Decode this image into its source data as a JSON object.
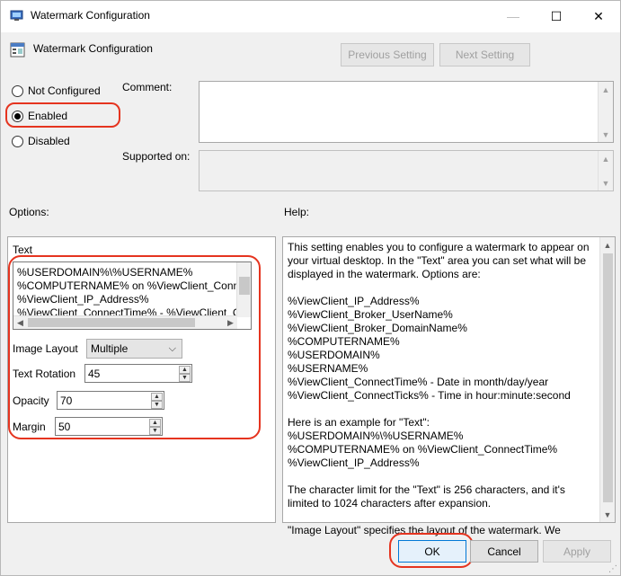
{
  "window": {
    "title": "Watermark Configuration",
    "controls": {
      "minimize": "—",
      "maximize": "☐",
      "close": "✕"
    }
  },
  "header": {
    "title": "Watermark Configuration",
    "prev_label": "Previous Setting",
    "next_label": "Next Setting"
  },
  "state": {
    "not_configured": "Not Configured",
    "enabled": "Enabled",
    "disabled": "Disabled",
    "selected": "Enabled"
  },
  "comment": {
    "label": "Comment:",
    "value": ""
  },
  "supported": {
    "label": "Supported on:",
    "value": ""
  },
  "options": {
    "label": "Options:",
    "text_label": "Text",
    "text_lines": [
      "%USERDOMAIN%\\%USERNAME%",
      "%COMPUTERNAME% on %ViewClient_Conne",
      "%ViewClient_IP_Address%",
      "%ViewClient_ConnectTime% - %ViewClient_C"
    ],
    "image_layout": {
      "label": "Image Layout",
      "value": "Multiple"
    },
    "text_rotation": {
      "label": "Text Rotation",
      "value": "45"
    },
    "opacity": {
      "label": "Opacity",
      "value": "70"
    },
    "margin": {
      "label": "Margin",
      "value": "50"
    }
  },
  "help": {
    "label": "Help:",
    "lines": [
      "This setting enables you to configure a watermark to appear on",
      "your virtual desktop. In the \"Text\" area you can set what will be",
      "displayed in the watermark. Options are:",
      "",
      "%ViewClient_IP_Address%",
      "%ViewClient_Broker_UserName%",
      "%ViewClient_Broker_DomainName%",
      "%COMPUTERNAME%",
      "%USERDOMAIN%",
      "%USERNAME%",
      "%ViewClient_ConnectTime%   - Date in month/day/year",
      "%ViewClient_ConnectTicks%  - Time in hour:minute:second",
      "",
      "Here is an example for \"Text\":",
      "%USERDOMAIN%\\%USERNAME%",
      "%COMPUTERNAME% on %ViewClient_ConnectTime%",
      "%ViewClient_IP_Address%",
      "",
      "The character limit for the \"Text\" is 256 characters, and it's",
      "limited to 1024 characters after expansion.",
      "",
      "\"Image Layout\" specifies the layout of the watermark. We"
    ]
  },
  "footer": {
    "ok_label": "OK",
    "cancel_label": "Cancel",
    "apply_label": "Apply"
  },
  "colors": {
    "highlight": "#e5341f",
    "focus_border": "#0078d7"
  }
}
